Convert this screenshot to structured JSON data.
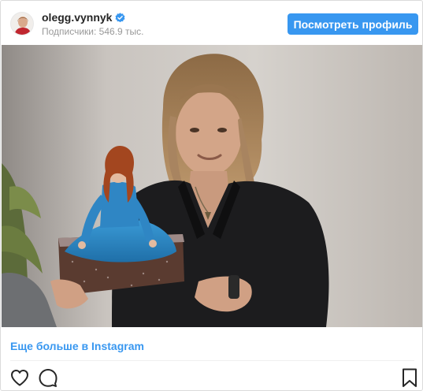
{
  "header": {
    "username": "olegg.vynnyk",
    "followers_text": "Подписчики: 546.9 тыс.",
    "view_profile_label": "Посмотреть профиль"
  },
  "footer": {
    "more_link_label": "Еще больше в Instagram"
  },
  "colors": {
    "accent": "#3897f0",
    "verified_badge": "#3897f0"
  },
  "icons": {
    "like": "heart-icon",
    "comment": "comment-icon",
    "save": "bookmark-icon",
    "verified": "verified-badge-icon"
  }
}
